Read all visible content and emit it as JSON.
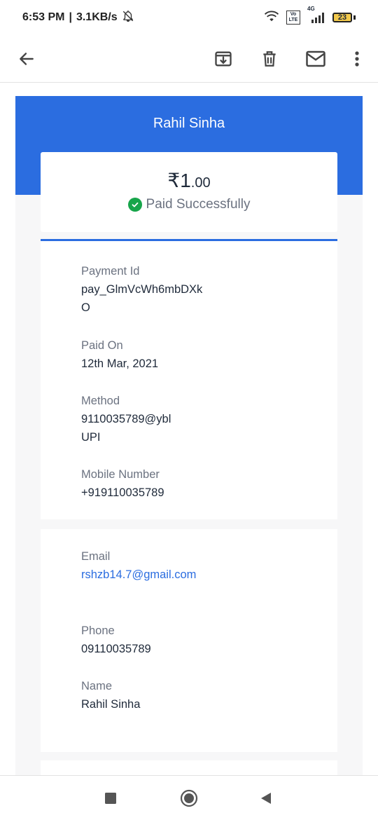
{
  "status_bar": {
    "time": "6:53 PM",
    "speed": "3.1KB/s",
    "network_type": "4G",
    "volte": "Vo LTE",
    "battery": "23",
    "icons": [
      "bell-off-icon",
      "wifi-icon",
      "signal-icon",
      "battery-icon"
    ]
  },
  "toolbar": {
    "icons": [
      "back-arrow-icon",
      "archive-icon",
      "delete-icon",
      "mail-icon",
      "more-vert-icon"
    ]
  },
  "receipt": {
    "merchant_name": "Rahil Sinha",
    "amount_main": "₹1",
    "amount_decimal": ".00",
    "status": "Paid Successfully",
    "details": [
      {
        "label": "Payment Id",
        "value": "pay_GlmVcWh6mbDXkO"
      },
      {
        "label": "Paid On",
        "value": "12th Mar, 2021"
      },
      {
        "label": "Method",
        "value": "9110035789@ybl UPI"
      },
      {
        "label": "Mobile Number",
        "value": "+919110035789"
      }
    ],
    "contact": [
      {
        "label": "Email",
        "value": "rshzb14.7@gmail.com"
      },
      {
        "label": "Phone",
        "value": "09110035789"
      },
      {
        "label": "Name",
        "value": "Rahil Sinha"
      }
    ]
  },
  "colors": {
    "primary": "#2b6de0",
    "success": "#17a54a",
    "muted_text": "#6b7280"
  },
  "nav_bar": {
    "icons": [
      "recents-square-icon",
      "home-circle-icon",
      "back-triangle-icon"
    ]
  }
}
